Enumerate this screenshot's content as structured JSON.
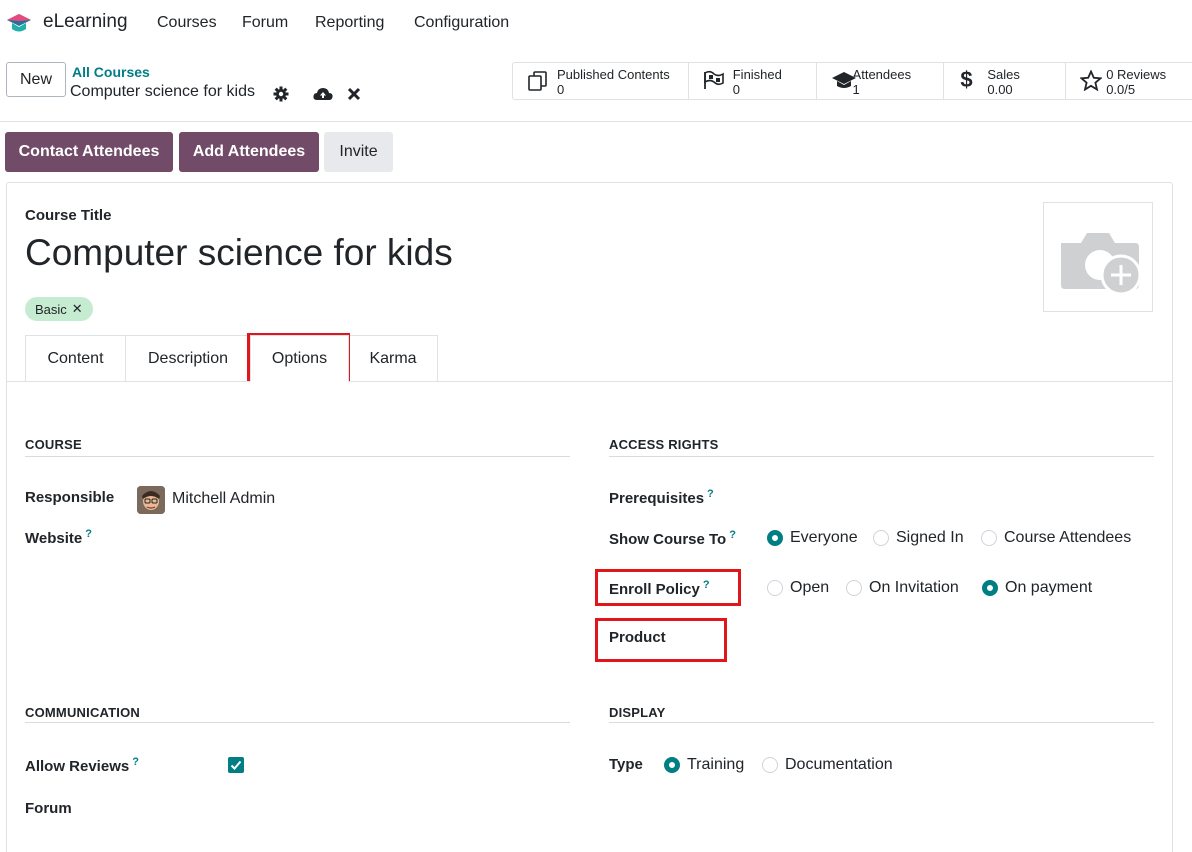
{
  "navbar": {
    "app_name": "eLearning",
    "menus": [
      "Courses",
      "Forum",
      "Reporting",
      "Configuration"
    ]
  },
  "control_panel": {
    "new_label": "New",
    "breadcrumb_parent": "All Courses",
    "breadcrumb_current": "Computer science for kids",
    "stats": [
      {
        "label": "Published Contents",
        "value": "0",
        "icon": "copy-icon"
      },
      {
        "label": "Finished",
        "value": "0",
        "icon": "flag-checkered-icon"
      },
      {
        "label": "Attendees",
        "value": "1",
        "icon": "graduation-cap-icon"
      },
      {
        "label": "Sales",
        "value": "0.00",
        "icon": "dollar-icon"
      },
      {
        "label": "0 Reviews",
        "value": "0.0/5",
        "icon": "star-icon"
      }
    ]
  },
  "actions": {
    "contact_attendees": "Contact Attendees",
    "add_attendees": "Add Attendees",
    "invite": "Invite"
  },
  "form": {
    "course_title_label": "Course Title",
    "course_title": "Computer science for kids",
    "tag": "Basic",
    "tag_remove": "✕",
    "tabs": [
      "Content",
      "Description",
      "Options",
      "Karma"
    ],
    "active_tab": "Options",
    "help_mark": "?",
    "course_group": {
      "title": "COURSE",
      "responsible_label": "Responsible",
      "responsible_value": "Mitchell Admin",
      "website_label": "Website"
    },
    "access_group": {
      "title": "ACCESS RIGHTS",
      "prerequisites_label": "Prerequisites",
      "show_course_label": "Show Course To",
      "show_course_options": [
        "Everyone",
        "Signed In",
        "Course Attendees"
      ],
      "show_course_selected": "Everyone",
      "enroll_label": "Enroll Policy",
      "enroll_options": [
        "Open",
        "On Invitation",
        "On payment"
      ],
      "enroll_selected": "On payment",
      "product_label": "Product"
    },
    "communication_group": {
      "title": "COMMUNICATION",
      "allow_reviews_label": "Allow Reviews",
      "allow_reviews_checked": true,
      "forum_label": "Forum"
    },
    "display_group": {
      "title": "DISPLAY",
      "type_label": "Type",
      "type_options": [
        "Training",
        "Documentation"
      ],
      "type_selected": "Training"
    }
  },
  "colors": {
    "primary": "#714b67",
    "accent": "#017e84",
    "highlight": "#e0161b",
    "tag_bg": "#c5ecd0"
  }
}
